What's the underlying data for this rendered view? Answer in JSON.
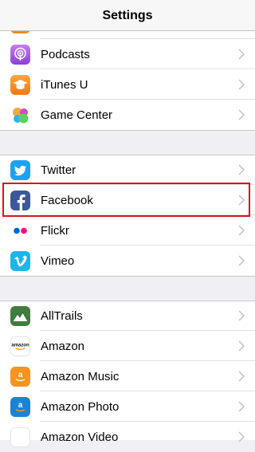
{
  "navbar": {
    "title": "Settings"
  },
  "group1": {
    "items": [
      {
        "label": "",
        "icon": "app-icon-partial"
      },
      {
        "label": "Podcasts",
        "icon": "podcasts-icon"
      },
      {
        "label": "iTunes U",
        "icon": "itunes-u-icon"
      },
      {
        "label": "Game Center",
        "icon": "game-center-icon"
      }
    ]
  },
  "group2": {
    "items": [
      {
        "label": "Twitter",
        "icon": "twitter-icon"
      },
      {
        "label": "Facebook",
        "icon": "facebook-icon",
        "highlighted": true
      },
      {
        "label": "Flickr",
        "icon": "flickr-icon"
      },
      {
        "label": "Vimeo",
        "icon": "vimeo-icon"
      }
    ]
  },
  "group3": {
    "items": [
      {
        "label": "AllTrails",
        "icon": "alltrails-icon"
      },
      {
        "label": "Amazon",
        "icon": "amazon-icon"
      },
      {
        "label": "Amazon Music",
        "icon": "amazon-music-icon"
      },
      {
        "label": "Amazon Photo",
        "icon": "amazon-photo-icon"
      },
      {
        "label": "Amazon Video",
        "icon": "amazon-video-icon"
      }
    ]
  },
  "icon_labels": {
    "amazon_word": "amazon"
  },
  "colors": {
    "highlight_border": "#d7141a",
    "chevron": "#c7c7cc",
    "background": "#efeff4"
  }
}
